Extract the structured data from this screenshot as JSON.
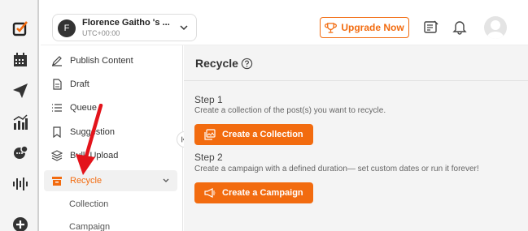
{
  "account": {
    "name": "Florence Gaitho 's ...",
    "timezone": "UTC+00:00",
    "initial": "F"
  },
  "header": {
    "upgrade_label": "Upgrade Now"
  },
  "sidebar": {
    "items": [
      {
        "label": "Publish Content",
        "icon": "pen-icon"
      },
      {
        "label": "Draft",
        "icon": "document-icon"
      },
      {
        "label": "Queue",
        "icon": "list-icon"
      },
      {
        "label": "Suggestion",
        "icon": "bookmark-icon"
      },
      {
        "label": "Bulk Upload",
        "icon": "layers-icon"
      },
      {
        "label": "Recycle",
        "icon": "recycle-box-icon",
        "active": true
      }
    ],
    "sub_items": [
      {
        "label": "Collection"
      },
      {
        "label": "Campaign"
      }
    ]
  },
  "page": {
    "title": "Recycle",
    "step1": {
      "title": "Step 1",
      "desc": "Create a collection of the post(s) you want to recycle.",
      "button": "Create a Collection"
    },
    "step2": {
      "title": "Step 2",
      "desc": "Create a campaign with a defined duration— set custom dates or run it forever!",
      "button": "Create a Campaign"
    }
  },
  "colors": {
    "accent": "#f26b0f",
    "annotation_arrow": "#e3141b"
  }
}
